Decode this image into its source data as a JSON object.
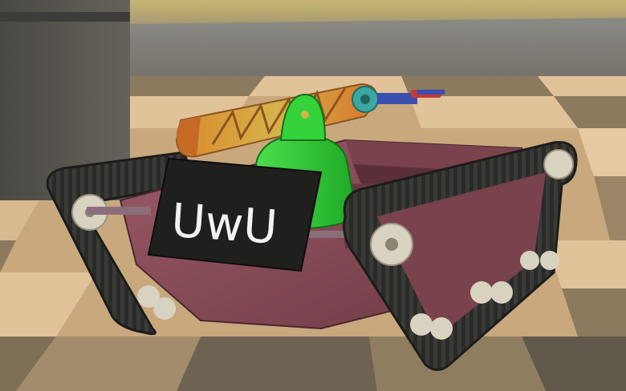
{
  "scene": {
    "description_tag": "robot-tank-3d-render",
    "sign_text": "UwU",
    "colors": {
      "sky_band": "#c9b56a",
      "floor_light": "#d9b98f",
      "floor_dark": "#8b7a5e",
      "wall": "#5a5650",
      "hull": "#8a4f5a",
      "track": "#2a2b28",
      "wheel": "#d8d2c0",
      "arm_orange": "#d9892c",
      "arm_yellow": "#d6b24a",
      "bell_green": "#36d23a",
      "sign_bg": "#1f201d",
      "sign_fg": "#f2f2ee",
      "turret_teal": "#3aa7a0",
      "turret_blue": "#3a4fb0"
    }
  }
}
